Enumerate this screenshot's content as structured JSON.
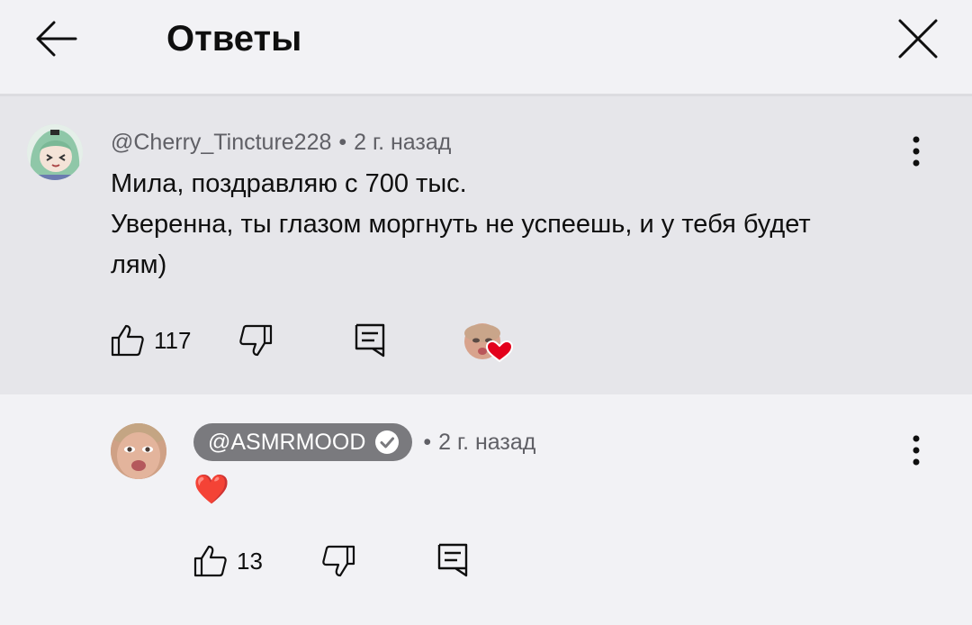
{
  "header": {
    "title": "Ответы",
    "back_icon": "arrow-left-icon",
    "close_icon": "close-icon"
  },
  "main_comment": {
    "author": "@Cherry_Tincture228",
    "separator": "•",
    "time": "2 г. назад",
    "text_line1": "Мила, поздравляю с 700 тыс.",
    "text_line2": "Уверенна, ты глазом моргнуть не успеешь, и у тебя будет",
    "text_line3": "лям)",
    "likes": "117",
    "heart_color": "#e3001b"
  },
  "reply": {
    "author": "@ASMRMOOD",
    "separator": "•",
    "time": "2 г. назад",
    "text": "❤️",
    "likes": "13"
  }
}
